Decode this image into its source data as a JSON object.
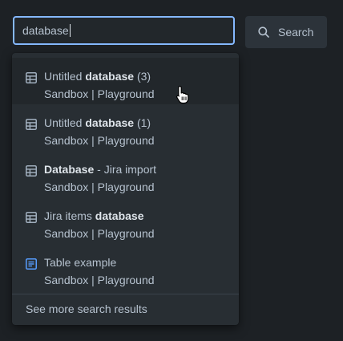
{
  "search": {
    "value": "database",
    "button_label": "Search",
    "icon": "search-icon"
  },
  "results": [
    {
      "icon": "database-table-icon",
      "title_pre": "Untitled ",
      "title_match": "database",
      "title_post": " (3)",
      "path": "Sandbox | Playground",
      "hovered": true
    },
    {
      "icon": "database-table-icon",
      "title_pre": "Untitled ",
      "title_match": "database",
      "title_post": " (1)",
      "path": "Sandbox | Playground",
      "hovered": false
    },
    {
      "icon": "database-table-icon",
      "title_pre": "",
      "title_match": "Database",
      "title_post": " - Jira import",
      "path": "Sandbox | Playground",
      "hovered": false
    },
    {
      "icon": "database-table-icon",
      "title_pre": "Jira items ",
      "title_match": "database",
      "title_post": "",
      "path": "Sandbox | Playground",
      "hovered": false
    },
    {
      "icon": "page-icon",
      "title_pre": "Table example",
      "title_match": "",
      "title_post": "",
      "path": "Sandbox | Playground",
      "hovered": false
    }
  ],
  "see_more_label": "See more search results",
  "colors": {
    "background": "#1d2125",
    "dropdown": "#282e33",
    "hover_row": "#22272b",
    "focus_border": "#85b8ff",
    "page_icon": "#579dff"
  }
}
